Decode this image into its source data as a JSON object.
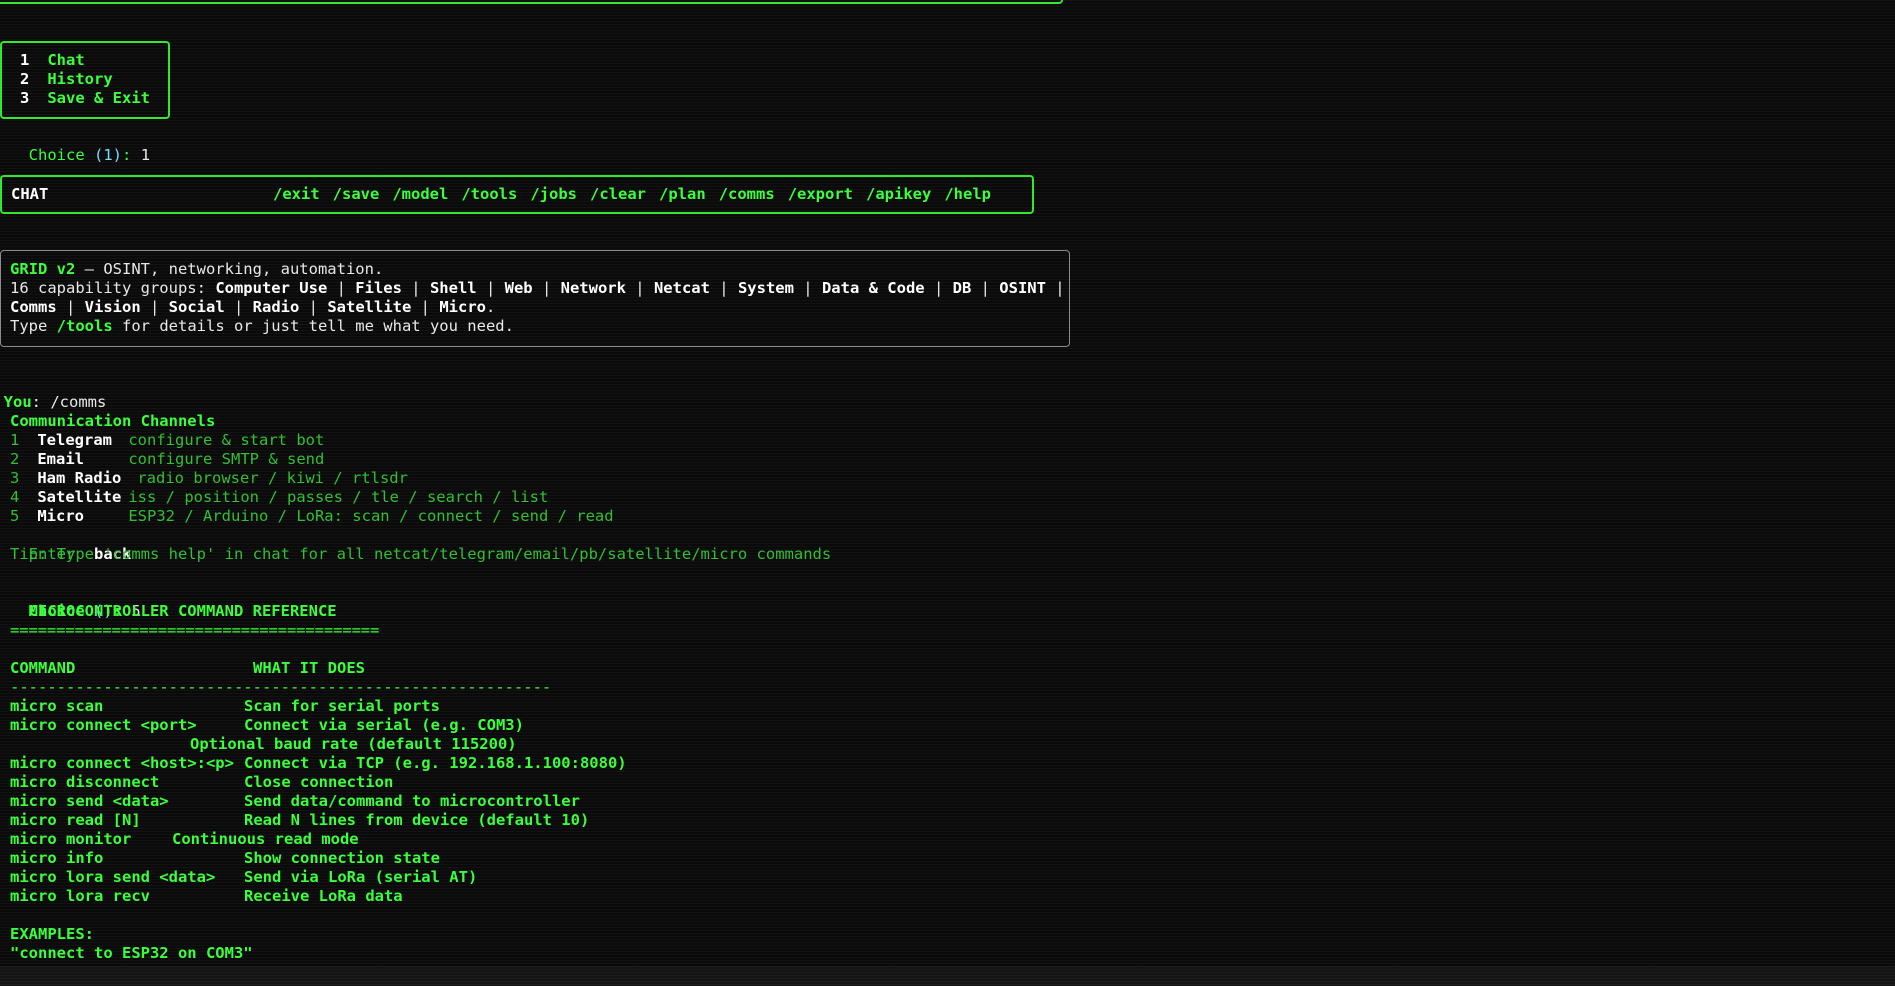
{
  "menu": {
    "items": [
      {
        "num": "1",
        "label": "Chat"
      },
      {
        "num": "2",
        "label": "History"
      },
      {
        "num": "3",
        "label": "Save & Exit"
      }
    ],
    "choice_label": "Choice",
    "choice_default": "(1)",
    "choice_sep": ": ",
    "choice_value": "1"
  },
  "chat_bar": {
    "title": "CHAT",
    "commands": [
      "/exit",
      "/save",
      "/model",
      "/tools",
      "/jobs",
      "/clear",
      "/plan",
      "/comms",
      "/export",
      "/apikey",
      "/help"
    ]
  },
  "intro": {
    "name": "GRID v2",
    "tagline": " — OSINT, networking, automation.",
    "cap_prefix": "16 capability groups: ",
    "groups_line1": [
      "Computer Use",
      "Files",
      "Shell",
      "Web",
      "Network",
      "Netcat",
      "System",
      "Data & Code",
      "DB",
      "OSINT"
    ],
    "groups_line2": [
      "Comms",
      "Vision",
      "Social",
      "Radio",
      "Satellite",
      "Micro"
    ],
    "tail_prefix": "Type ",
    "tail_cmd": "/tools",
    "tail_suffix": " for details or just tell me what you need."
  },
  "user_input": {
    "label": "You",
    "text": ": /comms"
  },
  "comms": {
    "title": "Communication Channels",
    "channels": [
      {
        "num": "1",
        "name": "Telegram",
        "desc": "configure & start bot"
      },
      {
        "num": "2",
        "name": "Email",
        "desc": "configure SMTP & send"
      },
      {
        "num": "3",
        "name": "Ham Radio",
        "desc": "radio browser / kiwi / rtlsdr"
      },
      {
        "num": "4",
        "name": "Satellite",
        "desc": "iss / position / passes / tle / search / list"
      },
      {
        "num": "5",
        "name": "Micro",
        "desc": "ESP32 / Arduino / LoRa: scan / connect / send / read"
      }
    ],
    "enter_key": "Enter",
    "enter_action": "back",
    "tip": "Tip: Type 'comms help' in chat for all netcat/telegram/email/pb/satellite/micro commands",
    "choice_label": "Choice",
    "choice_default": "()",
    "choice_sep": ": ",
    "choice_value": "5"
  },
  "reference": {
    "title": "  MICROCONTROLLER COMMAND REFERENCE",
    "rule": "========================================",
    "col_command": "COMMAND",
    "col_desc": "WHAT IT DOES",
    "divider": "----------------------------------------------------------",
    "rows": [
      {
        "cmd": "micro scan",
        "desc": "Scan for serial ports"
      },
      {
        "cmd": "micro connect <port>",
        "desc": "Connect via serial (e.g. COM3)"
      },
      {
        "cmd": "",
        "desc": "Optional baud rate (default 115200)"
      },
      {
        "cmd": "micro connect <host>:<p>",
        "desc": "Connect via TCP (e.g. 192.168.1.100:8080)"
      },
      {
        "cmd": "micro disconnect",
        "desc": "Close connection"
      },
      {
        "cmd": "micro send <data>",
        "desc": "Send data/command to microcontroller"
      },
      {
        "cmd": "micro read [N]",
        "desc": "Read N lines from device (default 10)"
      },
      {
        "cmd": "micro monitor",
        "desc": "Continuous read mode"
      },
      {
        "cmd": "micro info",
        "desc": "Show connection state"
      },
      {
        "cmd": "micro lora send <data>",
        "desc": "Send via LoRa (serial AT)"
      },
      {
        "cmd": "micro lora recv",
        "desc": "Receive LoRa data"
      }
    ],
    "examples_label": "EXAMPLES:",
    "examples": [
      "\"connect to ESP32 on COM3\""
    ]
  }
}
